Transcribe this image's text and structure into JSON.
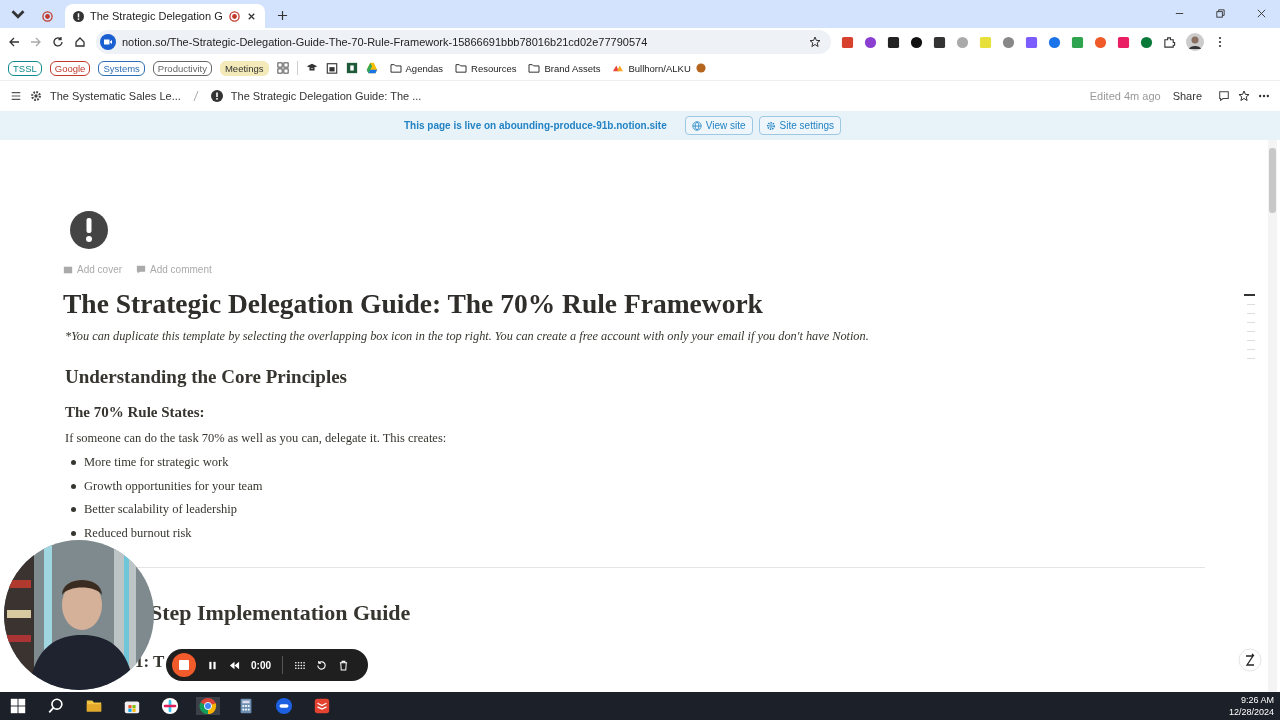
{
  "browser": {
    "tabs": [
      {
        "selected": false
      },
      {
        "title": "The Strategic Delegation G",
        "selected": true
      }
    ],
    "url": "notion.so/The-Strategic-Delegation-Guide-The-70-Rule-Framework-15866691bbb78016b21cd02e77790574",
    "bookmarks": [
      {
        "label": "TSSL",
        "kind": "pill",
        "color": "#0f8a8a"
      },
      {
        "label": "Google",
        "kind": "pill",
        "color": "#c0392b"
      },
      {
        "label": "Systems",
        "kind": "pill",
        "color": "#2c6fb5"
      },
      {
        "label": "Productivity",
        "kind": "pill",
        "color": "#666666"
      },
      {
        "label": "Meetings",
        "kind": "tag",
        "color": "#f4e9b8"
      },
      {
        "label": "Agendas",
        "kind": "folder"
      },
      {
        "label": "Resources",
        "kind": "folder"
      },
      {
        "label": "Brand Assets",
        "kind": "folder"
      },
      {
        "label": "Bullhorn/ALKU",
        "kind": "link"
      }
    ]
  },
  "notion": {
    "breadcrumbs": [
      "The Systematic Sales Le...",
      "The Strategic Delegation Guide: The ..."
    ],
    "edited": "Edited 4m ago",
    "share": "Share",
    "banner": {
      "text": "This page is live on abounding-produce-91b.notion.site",
      "buttons": [
        "View site",
        "Site settings"
      ]
    }
  },
  "page": {
    "actions": [
      "Add cover",
      "Add comment"
    ],
    "title": "The Strategic Delegation Guide: The 70% Rule Framework",
    "note": "*You can duplicate this template by selecting the overlapping box icon in the top right. You can create a free account with only your email if you don't have Notion.",
    "blocks": [
      {
        "kind": "h2",
        "text": "Understanding the Core Principles"
      },
      {
        "kind": "h3",
        "text": "The 70% Rule States:"
      },
      {
        "kind": "p",
        "text": "If someone can do the task 70% as well as you can, delegate it. This creates:"
      },
      {
        "kind": "bullet",
        "text": "More time for strategic work"
      },
      {
        "kind": "bullet",
        "text": "Growth opportunities for your team"
      },
      {
        "kind": "bullet",
        "text": "Better scalability of leadership"
      },
      {
        "kind": "bullet",
        "text": "Reduced burnout risk"
      },
      {
        "kind": "divider"
      },
      {
        "kind": "h2cut",
        "text": "Step Implementation Guide"
      },
      {
        "kind": "h3cut",
        "text": "1: T"
      }
    ]
  },
  "recorder": {
    "time": "0:00"
  },
  "taskbar": {
    "time": "9:26 AM",
    "date": "12/28/2024"
  }
}
